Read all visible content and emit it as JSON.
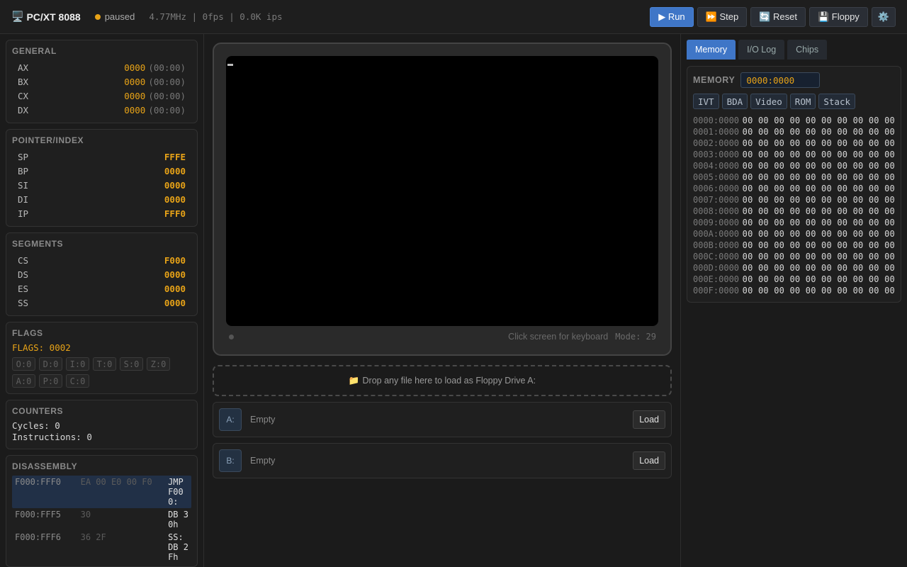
{
  "header": {
    "title_icon": "🖥️",
    "title": "PC/XT 8088",
    "status": "paused",
    "status_color": "#e8a317",
    "stats": "4.77MHz | 0fps | 0.0K ips",
    "buttons": {
      "run": "▶ Run",
      "step": "⏩ Step",
      "reset": "🔄 Reset",
      "floppy": "💾 Floppy",
      "settings": "⚙️"
    }
  },
  "registers": {
    "general": {
      "title": "GENERAL",
      "rows": [
        {
          "name": "AX",
          "value": "0000",
          "sub": "(00:00)"
        },
        {
          "name": "BX",
          "value": "0000",
          "sub": "(00:00)"
        },
        {
          "name": "CX",
          "value": "0000",
          "sub": "(00:00)"
        },
        {
          "name": "DX",
          "value": "0000",
          "sub": "(00:00)"
        }
      ]
    },
    "pointer": {
      "title": "POINTER/INDEX",
      "rows": [
        {
          "name": "SP",
          "value": "FFFE"
        },
        {
          "name": "BP",
          "value": "0000"
        },
        {
          "name": "SI",
          "value": "0000"
        },
        {
          "name": "DI",
          "value": "0000"
        },
        {
          "name": "IP",
          "value": "FFF0"
        }
      ]
    },
    "segments": {
      "title": "SEGMENTS",
      "rows": [
        {
          "name": "CS",
          "value": "F000"
        },
        {
          "name": "DS",
          "value": "0000"
        },
        {
          "name": "ES",
          "value": "0000"
        },
        {
          "name": "SS",
          "value": "0000"
        }
      ]
    }
  },
  "flags": {
    "title": "FLAGS",
    "value": "FLAGS: 0002",
    "items": [
      "O:0",
      "D:0",
      "I:0",
      "T:0",
      "S:0",
      "Z:0",
      "A:0",
      "P:0",
      "C:0"
    ]
  },
  "counters": {
    "title": "COUNTERS",
    "cycles": "Cycles: 0",
    "instructions": "Instructions: 0"
  },
  "disassembly": {
    "title": "DISASSEMBLY",
    "rows": [
      {
        "addr": "F000:FFF0",
        "bytes": "EA 00 E0 00 F0",
        "inst": "JMP F000:"
      },
      {
        "addr": "F000:FFF5",
        "bytes": "30",
        "inst": "DB 30h"
      },
      {
        "addr": "F000:FFF6",
        "bytes": "36 2F",
        "inst": "SS: DB 2Fh"
      }
    ]
  },
  "monitor": {
    "hint": "Click screen for keyboard",
    "mode": "Mode: 29"
  },
  "dropzone": {
    "icon": "📁",
    "text": "Drop any file here to load as Floppy Drive A:"
  },
  "drives": [
    {
      "label": "A:",
      "name": "Empty",
      "button": "Load"
    },
    {
      "label": "B:",
      "name": "Empty",
      "button": "Load"
    }
  ],
  "right_tabs": [
    "Memory",
    "I/O Log",
    "Chips"
  ],
  "memory": {
    "title": "MEMORY",
    "address": "0000:0000",
    "quick": [
      "IVT",
      "BDA",
      "Video",
      "ROM",
      "Stack"
    ],
    "rows": [
      {
        "addr": "0000:0000",
        "bytes": "00 00 00 00 00 00 00 00 00 00"
      },
      {
        "addr": "0001:0000",
        "bytes": "00 00 00 00 00 00 00 00 00 00"
      },
      {
        "addr": "0002:0000",
        "bytes": "00 00 00 00 00 00 00 00 00 00"
      },
      {
        "addr": "0003:0000",
        "bytes": "00 00 00 00 00 00 00 00 00 00"
      },
      {
        "addr": "0004:0000",
        "bytes": "00 00 00 00 00 00 00 00 00 00"
      },
      {
        "addr": "0005:0000",
        "bytes": "00 00 00 00 00 00 00 00 00 00"
      },
      {
        "addr": "0006:0000",
        "bytes": "00 00 00 00 00 00 00 00 00 00"
      },
      {
        "addr": "0007:0000",
        "bytes": "00 00 00 00 00 00 00 00 00 00"
      },
      {
        "addr": "0008:0000",
        "bytes": "00 00 00 00 00 00 00 00 00 00"
      },
      {
        "addr": "0009:0000",
        "bytes": "00 00 00 00 00 00 00 00 00 00"
      },
      {
        "addr": "000A:0000",
        "bytes": "00 00 00 00 00 00 00 00 00 00"
      },
      {
        "addr": "000B:0000",
        "bytes": "00 00 00 00 00 00 00 00 00 00"
      },
      {
        "addr": "000C:0000",
        "bytes": "00 00 00 00 00 00 00 00 00 00"
      },
      {
        "addr": "000D:0000",
        "bytes": "00 00 00 00 00 00 00 00 00 00"
      },
      {
        "addr": "000E:0000",
        "bytes": "00 00 00 00 00 00 00 00 00 00"
      },
      {
        "addr": "000F:0000",
        "bytes": "00 00 00 00 00 00 00 00 00 00"
      }
    ]
  }
}
